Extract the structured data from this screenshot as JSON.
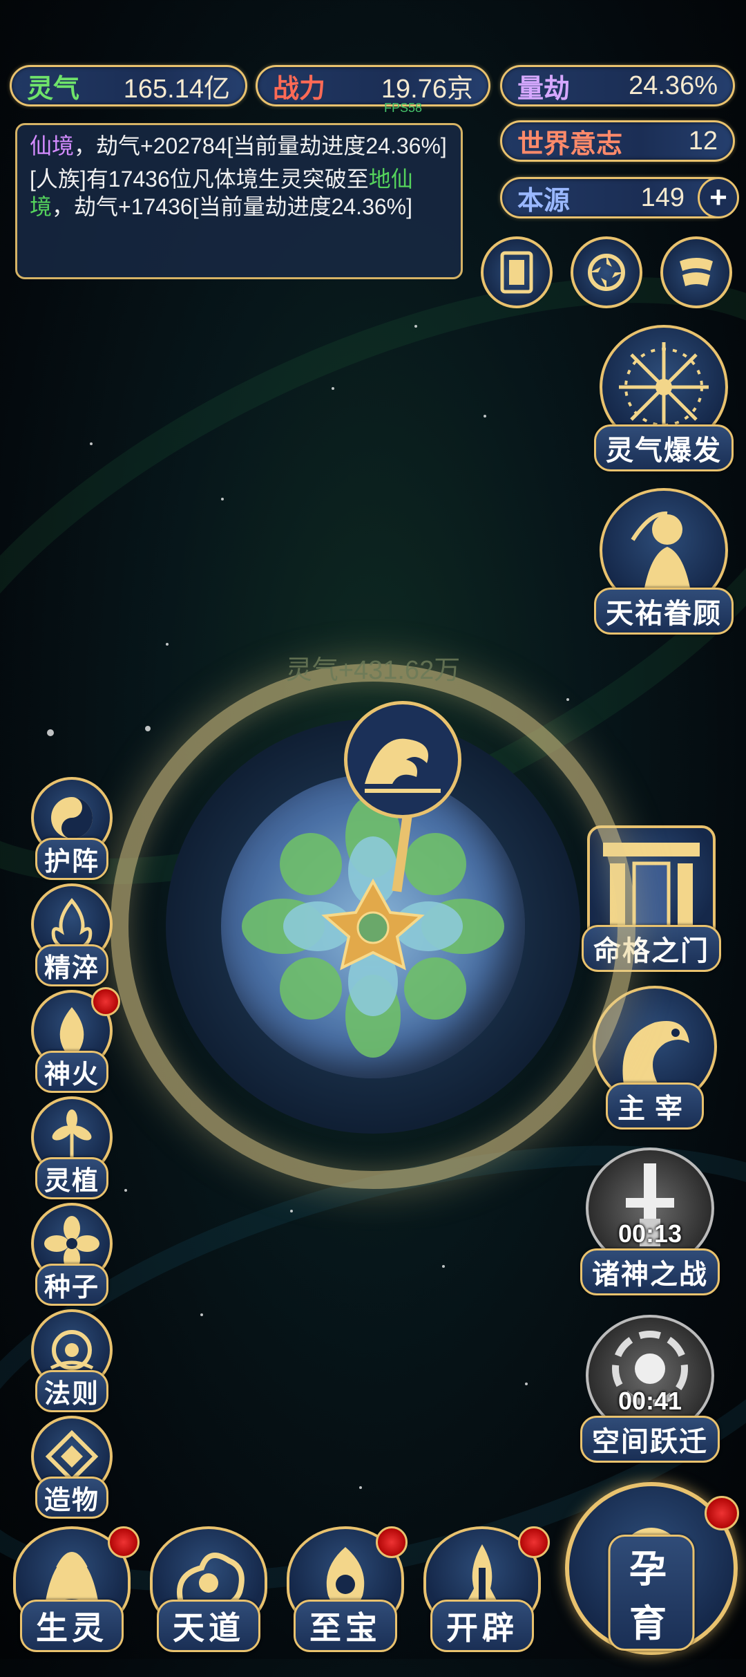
{
  "resources": {
    "lingqi": {
      "label": "灵气",
      "value": "165.14亿",
      "color": "#6fe36a"
    },
    "zhanli": {
      "label": "战力",
      "value": "19.76京",
      "color": "#ff6a55"
    },
    "liangjie": {
      "label": "量劫",
      "value": "24.36%",
      "color": "#d6a8ff"
    },
    "world_will": {
      "label": "世界意志",
      "value": "12",
      "color": "#ff8a6a"
    },
    "benyuan": {
      "label": "本源",
      "value": "149",
      "color": "#9ab8ff"
    }
  },
  "fps": "FPS58",
  "log": {
    "entry1": {
      "highlight": "仙境",
      "rest": "，劫气+202784[当前量劫进度24.36%]"
    },
    "entry2": {
      "part1": "[人族]有17436位凡体境生灵突破至",
      "highlight": "地仙境",
      "part2": "，劫气+17436[当前量劫进度24.36%]"
    }
  },
  "gain_text": "灵气+431.62万",
  "right_buttons": {
    "burst": "灵气爆发",
    "blessing": "天祐眷顾",
    "fate_gate": "命格之门",
    "ruler": "主宰",
    "gods_war": {
      "label": "诸神之战",
      "timer": "00:13"
    },
    "space_jump": {
      "label": "空间跃迁",
      "timer": "00:41"
    }
  },
  "left_buttons": [
    "护阵",
    "精淬",
    "神火",
    "灵植",
    "种子",
    "法则",
    "造物"
  ],
  "bottom_nav": [
    "生灵",
    "天道",
    "至宝",
    "开辟"
  ],
  "main_button": "孕育",
  "colors": {
    "gold": "#e9c26e",
    "panel": "#1b2e55"
  }
}
